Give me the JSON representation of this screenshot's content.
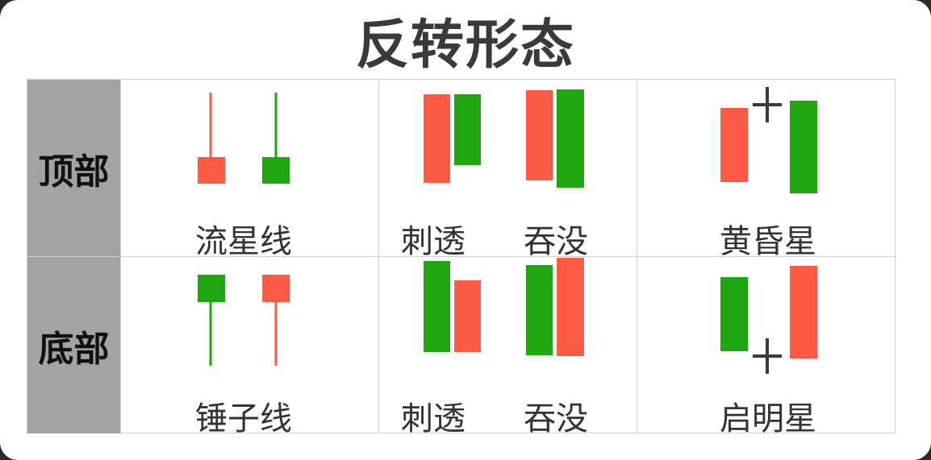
{
  "title": "反转形态",
  "colors": {
    "bull": "#ff5a44",
    "bear": "#1fa610",
    "header_bg": "#a3a3a3",
    "cross": "#3a3a3a"
  },
  "rows": [
    {
      "header": "顶部",
      "cells": [
        {
          "labels": [
            "流星线"
          ]
        },
        {
          "labels": [
            "刺透",
            "吞没"
          ]
        },
        {
          "labels": [
            "黄昏星"
          ]
        }
      ]
    },
    {
      "header": "底部",
      "cells": [
        {
          "labels": [
            "锤子线"
          ]
        },
        {
          "labels": [
            "刺透",
            "吞没"
          ]
        },
        {
          "labels": [
            "启明星"
          ]
        }
      ]
    }
  ]
}
